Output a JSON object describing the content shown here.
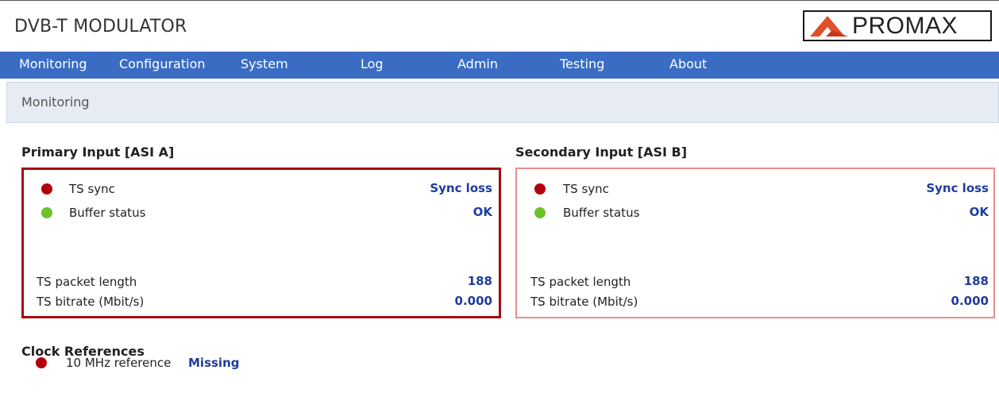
{
  "app": {
    "title": "DVB-T MODULATOR",
    "logo_text": "PROMAX"
  },
  "nav": {
    "items": [
      "Monitoring",
      "Configuration",
      "System",
      "Log",
      "Admin",
      "Testing",
      "About"
    ]
  },
  "breadcrumb": "Monitoring",
  "primary": {
    "title": "Primary Input [ASI A]",
    "ts_sync": {
      "label": "TS sync",
      "value": "Sync loss",
      "status": "red"
    },
    "buffer": {
      "label": "Buffer status",
      "value": "OK",
      "status": "green"
    },
    "packet_length": {
      "label": "TS packet length",
      "value": "188"
    },
    "bitrate": {
      "label": "TS bitrate (Mbit/s)",
      "value": "0.000"
    }
  },
  "secondary": {
    "title": "Secondary Input [ASI B]",
    "ts_sync": {
      "label": "TS sync",
      "value": "Sync loss",
      "status": "red"
    },
    "buffer": {
      "label": "Buffer status",
      "value": "OK",
      "status": "green"
    },
    "packet_length": {
      "label": "TS packet length",
      "value": "188"
    },
    "bitrate": {
      "label": "TS bitrate (Mbit/s)",
      "value": "0.000"
    }
  },
  "clock": {
    "title": "Clock References",
    "ref_10mhz": {
      "label": "10 MHz reference",
      "value": "Missing",
      "status": "red"
    }
  },
  "colors": {
    "nav_bg": "#3a6cc4",
    "value_text": "#1f3c9e",
    "status_red": "#b3000d",
    "status_green": "#6cc22a",
    "primary_border": "#a40b10",
    "secondary_border": "#ef8c8c"
  }
}
